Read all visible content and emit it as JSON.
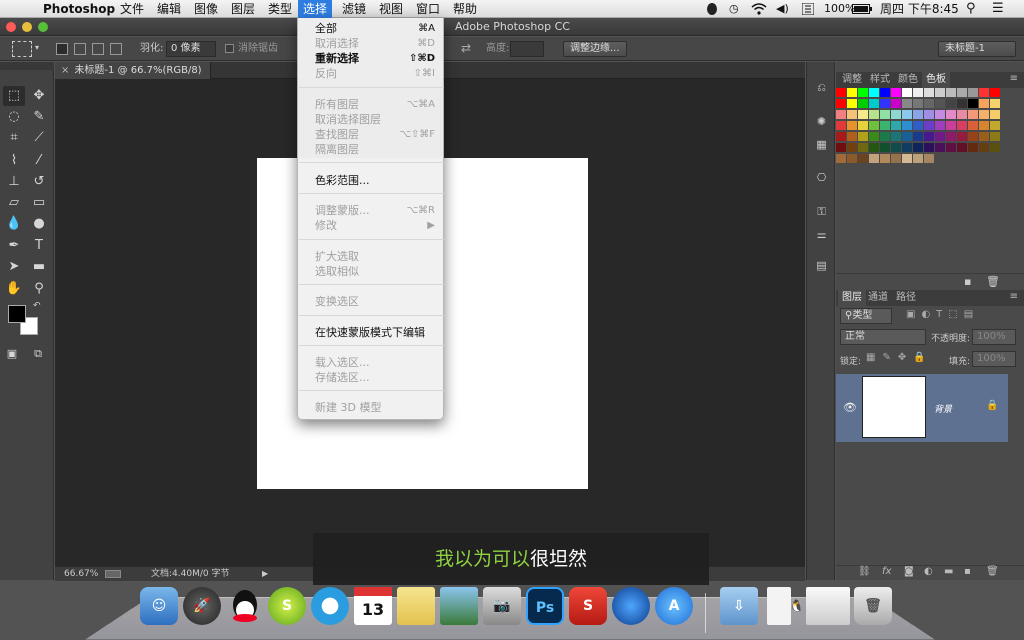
{
  "menubar": {
    "app": "Photoshop",
    "items": [
      "文件",
      "编辑",
      "图像",
      "图层",
      "类型",
      "选择",
      "滤镜",
      "视图",
      "窗口",
      "帮助"
    ],
    "active": "选择",
    "battery": "100%",
    "clock": "周四 下午8:45"
  },
  "window": {
    "title": "Adobe Photoshop CC"
  },
  "options_bar": {
    "feather_label": "羽化:",
    "feather_value": "0 像素",
    "antialias_label": "消除锯齿",
    "height_label": "高度:",
    "refine_button": "调整边缘...",
    "workspace": "未标题-1"
  },
  "document": {
    "tab_title": "未标题-1 @ 66.7%(RGB/8)",
    "zoom": "66.67%",
    "doc_info": "文档:4.40M/0 字节"
  },
  "select_menu": {
    "items": [
      {
        "label": "全部",
        "shortcut": "⌘A",
        "enabled": true,
        "bold": false
      },
      {
        "label": "取消选择",
        "shortcut": "⌘D",
        "enabled": false,
        "bold": false
      },
      {
        "label": "重新选择",
        "shortcut": "⇧⌘D",
        "enabled": true,
        "bold": true
      },
      {
        "label": "反向",
        "shortcut": "⇧⌘I",
        "enabled": false,
        "bold": false
      },
      {
        "label": "所有图层",
        "shortcut": "⌥⌘A",
        "enabled": false,
        "bold": false
      },
      {
        "label": "取消选择图层",
        "shortcut": "",
        "enabled": false,
        "bold": false
      },
      {
        "label": "查找图层",
        "shortcut": "⌥⇧⌘F",
        "enabled": false,
        "bold": false
      },
      {
        "label": "隔离图层",
        "shortcut": "",
        "enabled": false,
        "bold": false
      },
      {
        "label": "色彩范围...",
        "shortcut": "",
        "enabled": true,
        "bold": false
      },
      {
        "label": "调整蒙版...",
        "shortcut": "⌥⌘R",
        "enabled": false,
        "bold": false
      },
      {
        "label": "修改",
        "shortcut": "▶",
        "enabled": false,
        "bold": false
      },
      {
        "label": "扩大选取",
        "shortcut": "",
        "enabled": false,
        "bold": false
      },
      {
        "label": "选取相似",
        "shortcut": "",
        "enabled": false,
        "bold": false
      },
      {
        "label": "变换选区",
        "shortcut": "",
        "enabled": false,
        "bold": false
      },
      {
        "label": "在快速蒙版模式下编辑",
        "shortcut": "",
        "enabled": true,
        "bold": false
      },
      {
        "label": "载入选区...",
        "shortcut": "",
        "enabled": false,
        "bold": false
      },
      {
        "label": "存储选区...",
        "shortcut": "",
        "enabled": false,
        "bold": false
      },
      {
        "label": "新建 3D 模型",
        "shortcut": "",
        "enabled": false,
        "bold": false
      }
    ]
  },
  "swatch_panel": {
    "tabs": [
      "调整",
      "样式",
      "颜色",
      "色板"
    ],
    "active_tab": "色板"
  },
  "layers_panel": {
    "tabs": [
      "图层",
      "通道",
      "路径"
    ],
    "active_tab": "图层",
    "filter_kind": "类型",
    "blend_mode": "正常",
    "opacity_label": "不透明度:",
    "opacity_value": "100%",
    "lock_label": "锁定:",
    "fill_label": "填充:",
    "fill_value": "100%",
    "layer_name": "背景"
  },
  "subtitle": {
    "highlight": "我以为可以",
    "rest": "很坦然",
    "highlight_color": "#8fd13f"
  },
  "dock_apps": [
    "finder",
    "launchpad",
    "qq",
    "sync",
    "browser",
    "calendar",
    "notes",
    "iphoto",
    "image-capture",
    "photoshop",
    "wps",
    "globe",
    "app-store",
    "downloads",
    "document",
    "qq-mini",
    "preview",
    "trash"
  ],
  "calendar_day": "13"
}
